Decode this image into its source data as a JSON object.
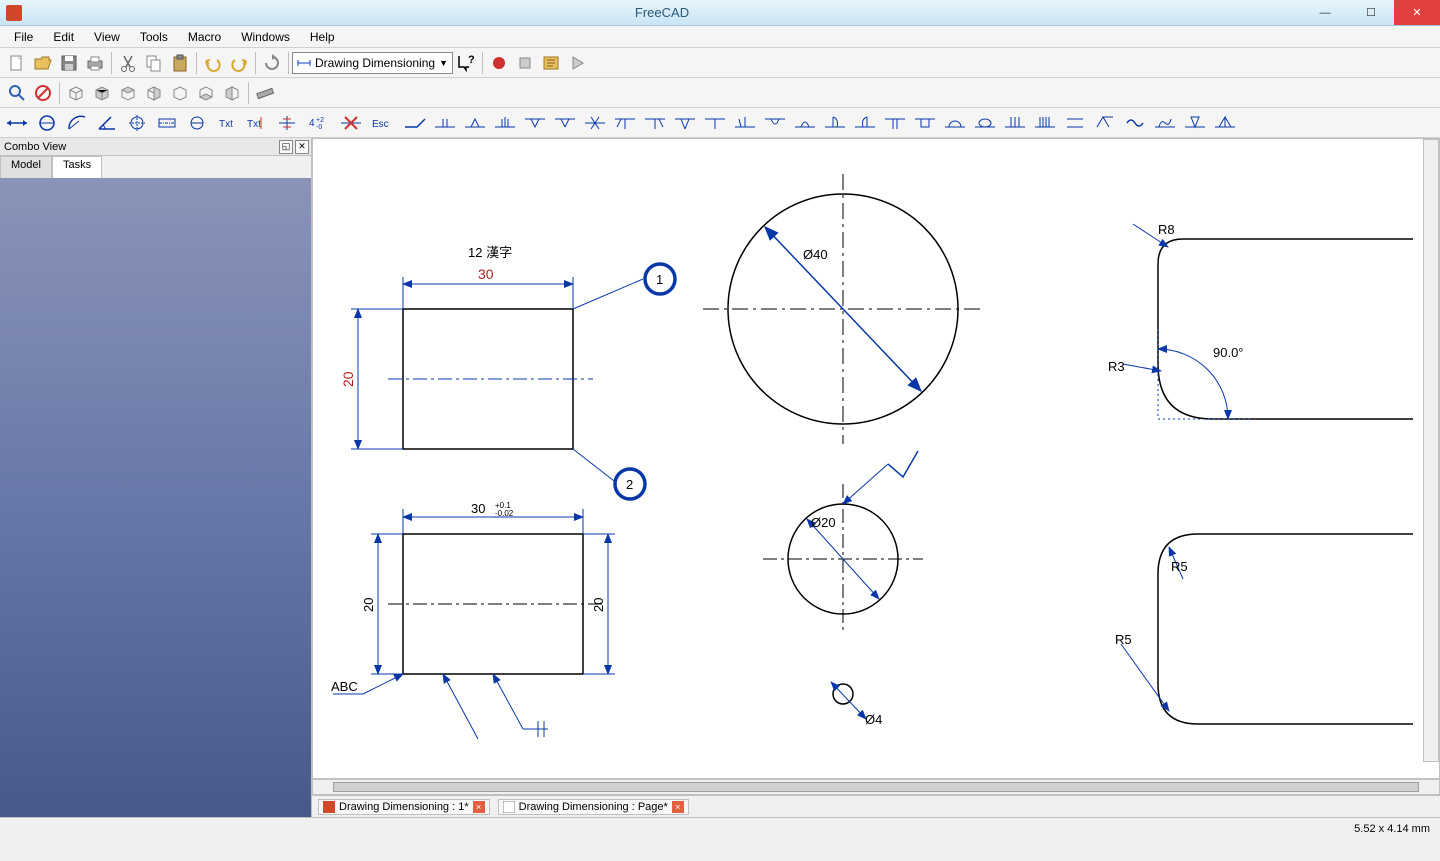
{
  "app": {
    "title": "FreeCAD"
  },
  "menu": {
    "items": [
      "File",
      "Edit",
      "View",
      "Tools",
      "Macro",
      "Windows",
      "Help"
    ]
  },
  "workbench": {
    "selected": "Drawing Dimensioning"
  },
  "combo": {
    "title": "Combo View",
    "tabs": [
      "Model",
      "Tasks"
    ],
    "active": 1
  },
  "doctabs": [
    {
      "label": "Drawing Dimensioning : 1*"
    },
    {
      "label": "Drawing Dimensioning : Page*"
    }
  ],
  "status": {
    "coords": "5.52 x 4.14 mm"
  },
  "drawing": {
    "rect1": {
      "w": "30",
      "h": "20",
      "note_top": "12  漢字"
    },
    "balloons": [
      "1",
      "2"
    ],
    "rect2": {
      "w": "30",
      "tol_up": "+0.1",
      "tol_dn": "-0.02",
      "h_left": "20",
      "h_right": "20",
      "note": "ABC"
    },
    "circ1": {
      "dia": "Ø40"
    },
    "circ2": {
      "dia": "Ø20"
    },
    "circ3": {
      "dia": "Ø4"
    },
    "rad": {
      "r8": "R8",
      "r3": "R3",
      "r5a": "R5",
      "r5b": "R5",
      "ang": "90.0°"
    }
  }
}
